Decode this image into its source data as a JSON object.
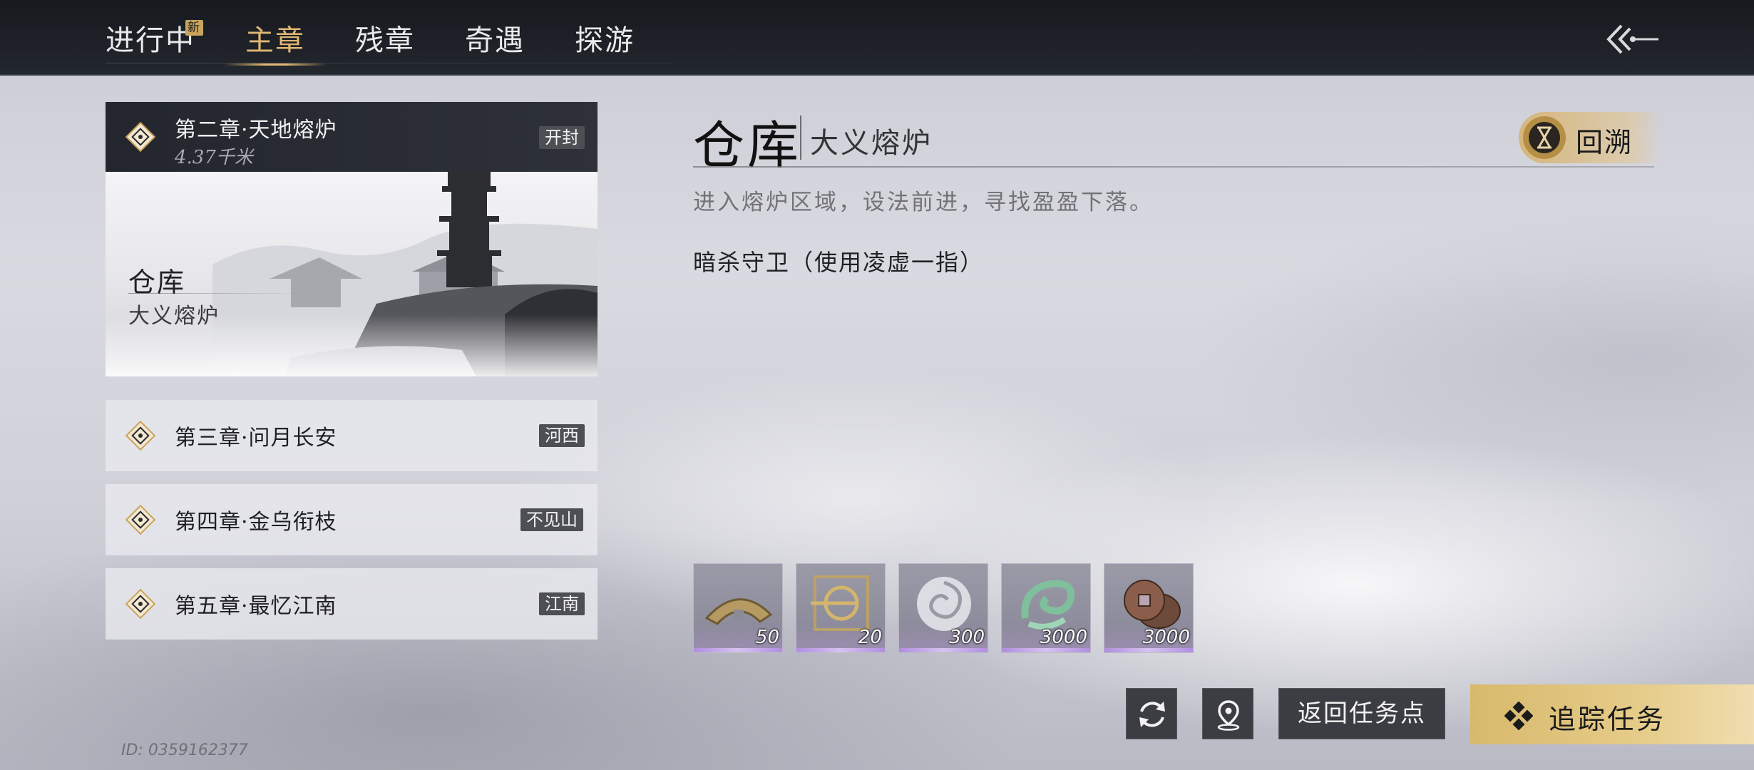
{
  "tabs": [
    {
      "label": "进行中",
      "badge": "新"
    },
    {
      "label": "主章"
    },
    {
      "label": "残章"
    },
    {
      "label": "奇遇"
    },
    {
      "label": "探游"
    }
  ],
  "active_tab": "主章",
  "current_chapter": {
    "title": "第二章·天地熔炉",
    "distance": "4.37千米",
    "location": "开封",
    "place": "仓库",
    "area": "大义熔炉"
  },
  "chapters": [
    {
      "title": "第三章·问月长安",
      "location": "河西"
    },
    {
      "title": "第四章·金乌衔枝",
      "location": "不见山"
    },
    {
      "title": "第五章·最忆江南",
      "location": "江南"
    }
  ],
  "detail": {
    "title": "仓库",
    "subtitle": "大义熔炉",
    "rewind_label": "回溯",
    "description": "进入熔炉区域，设法前进，寻找盈盈下落。",
    "objective": "暗杀守卫（使用凌虚一指）"
  },
  "rewards": [
    {
      "icon": "half-coin-icon",
      "count": "50"
    },
    {
      "icon": "gold-token-icon",
      "count": "20"
    },
    {
      "icon": "white-swirl-icon",
      "count": "300"
    },
    {
      "icon": "jade-swirl-icon",
      "count": "3000"
    },
    {
      "icon": "copper-coins-icon",
      "count": "3000"
    }
  ],
  "actions": {
    "refresh_icon": "refresh-icon",
    "locate_icon": "map-pin-icon",
    "return_label": "返回任务点",
    "track_label": "追踪任务"
  },
  "player_id": "ID: 0359162377",
  "colors": {
    "accent_gold": "#e1b773",
    "button_gold": "#d8b96c",
    "topbar": "#1b1e24",
    "dark_button": "#3b3d43"
  }
}
